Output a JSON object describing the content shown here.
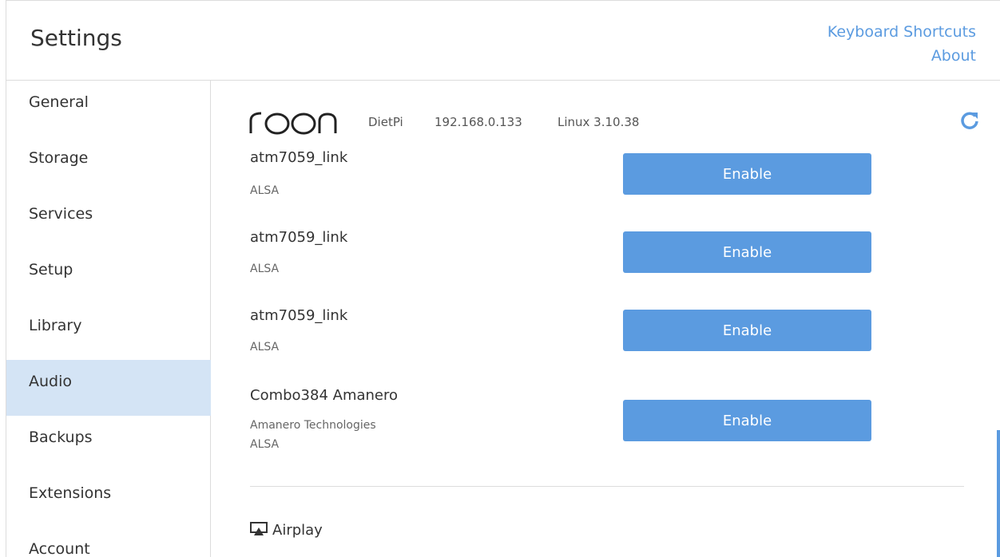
{
  "header": {
    "title": "Settings",
    "links": [
      "Keyboard Shortcuts",
      "About"
    ]
  },
  "sidebar": {
    "items": [
      {
        "label": "General",
        "active": false
      },
      {
        "label": "Storage",
        "active": false
      },
      {
        "label": "Services",
        "active": false
      },
      {
        "label": "Setup",
        "active": false
      },
      {
        "label": "Library",
        "active": false
      },
      {
        "label": "Audio",
        "active": true
      },
      {
        "label": "Backups",
        "active": false
      },
      {
        "label": "Extensions",
        "active": false
      },
      {
        "label": "Account",
        "active": false
      }
    ]
  },
  "core": {
    "brand": "roon",
    "name": "DietPi",
    "ip": "192.168.0.133",
    "os": "Linux 3.10.38",
    "refresh_icon": "refresh-icon"
  },
  "devices": [
    {
      "name": "atm7059_link",
      "sub1": "ALSA",
      "sub2": "",
      "button": "Enable"
    },
    {
      "name": "atm7059_link",
      "sub1": "ALSA",
      "sub2": "",
      "button": "Enable"
    },
    {
      "name": "atm7059_link",
      "sub1": "ALSA",
      "sub2": "",
      "button": "Enable"
    },
    {
      "name": "Combo384 Amanero",
      "sub1": "Amanero Technologies",
      "sub2": "ALSA",
      "button": "Enable"
    }
  ],
  "airplay": {
    "label": "Airplay",
    "icon": "airplay-icon"
  },
  "colors": {
    "accent": "#5b9be0",
    "active_nav": "#d4e4f5"
  }
}
